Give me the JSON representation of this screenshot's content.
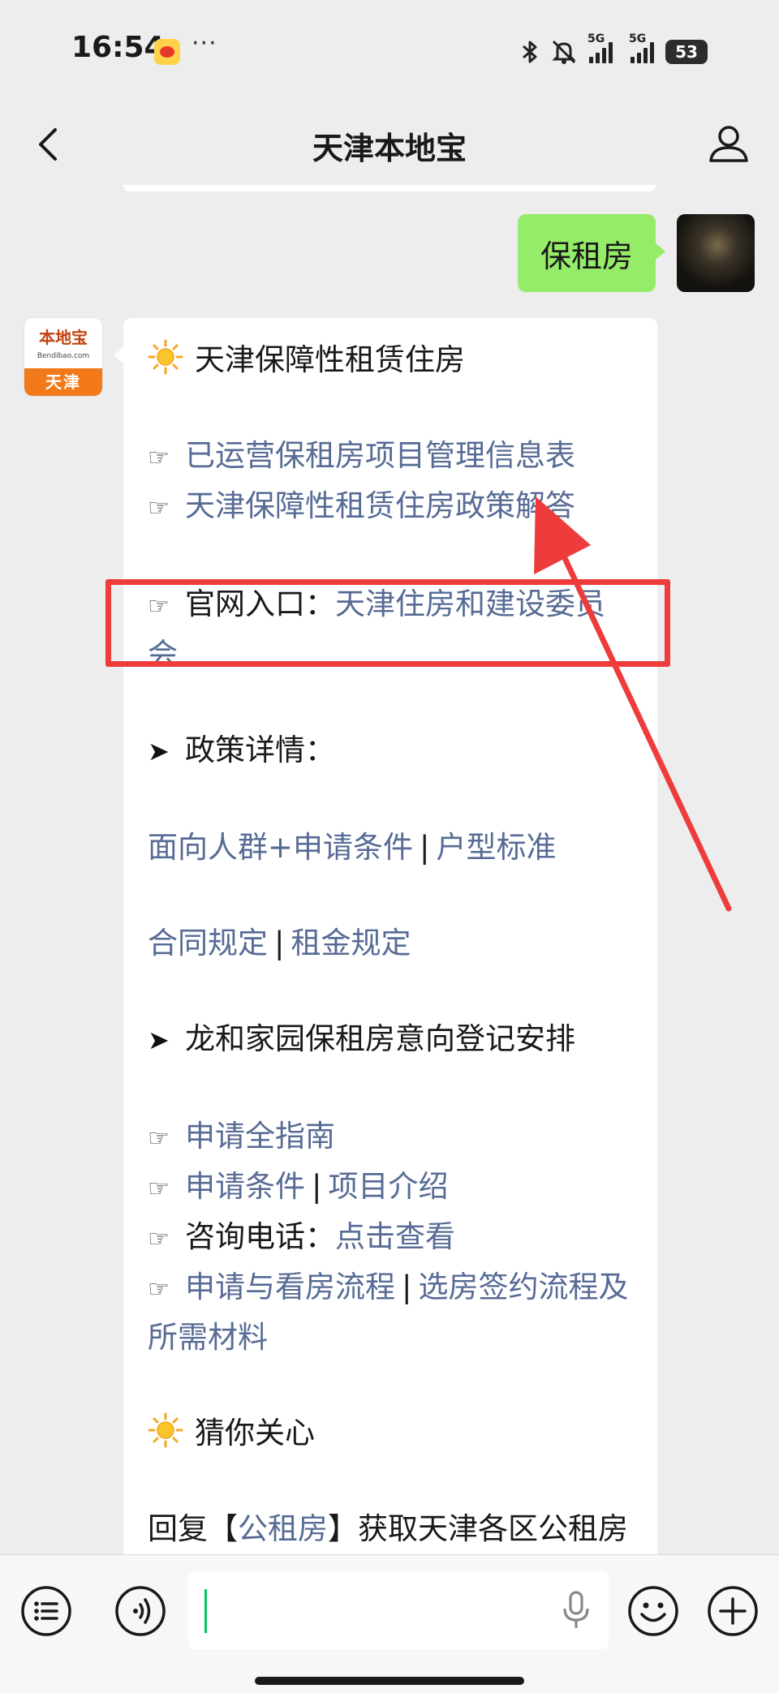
{
  "status_bar": {
    "time": "16:54",
    "dots": "···",
    "network_1": "5G",
    "network_2": "5G",
    "battery": "53"
  },
  "nav": {
    "title": "天津本地宝"
  },
  "user_message": {
    "text": "保租房"
  },
  "bot_avatar": {
    "logo_top": "本地宝",
    "logo_url": "Bendibao.com",
    "logo_city": "天津"
  },
  "bot_message": {
    "heading": "天津保障性租赁住房",
    "link_1": "已运营保租房项目管理信息表",
    "link_2": "天津保障性租赁住房政策解答",
    "official_label": "官网入口：",
    "official_link": "天津住房和建设委员会",
    "policy_heading": "政策详情：",
    "policy_link_a": "面向人群+申请条件",
    "policy_link_b": "户型标准",
    "policy_link_c": "合同规定",
    "policy_link_d": "租金规定",
    "section_heading": "龙和家园保租房意向登记安排",
    "guide_link": "申请全指南",
    "cond_link": "申请条件",
    "project_link": "项目介绍",
    "phone_label": "咨询电话：",
    "phone_link": "点击查看",
    "flow_link_a": "申请与看房流程",
    "flow_link_b": "选房签约流程及所需材料",
    "care_heading": "猜你关心",
    "reply_prefix": "回复【",
    "reply_link": "公租房",
    "reply_suffix": "】获取天津各区公租房房源信息＋申请入口及指南"
  },
  "icons": {
    "hand": "☞",
    "arrow": "➤",
    "separator": "|"
  },
  "colors": {
    "link": "#576b95",
    "user_bubble": "#95ec69",
    "highlight": "#ee3b3b",
    "accent": "#07c160"
  }
}
